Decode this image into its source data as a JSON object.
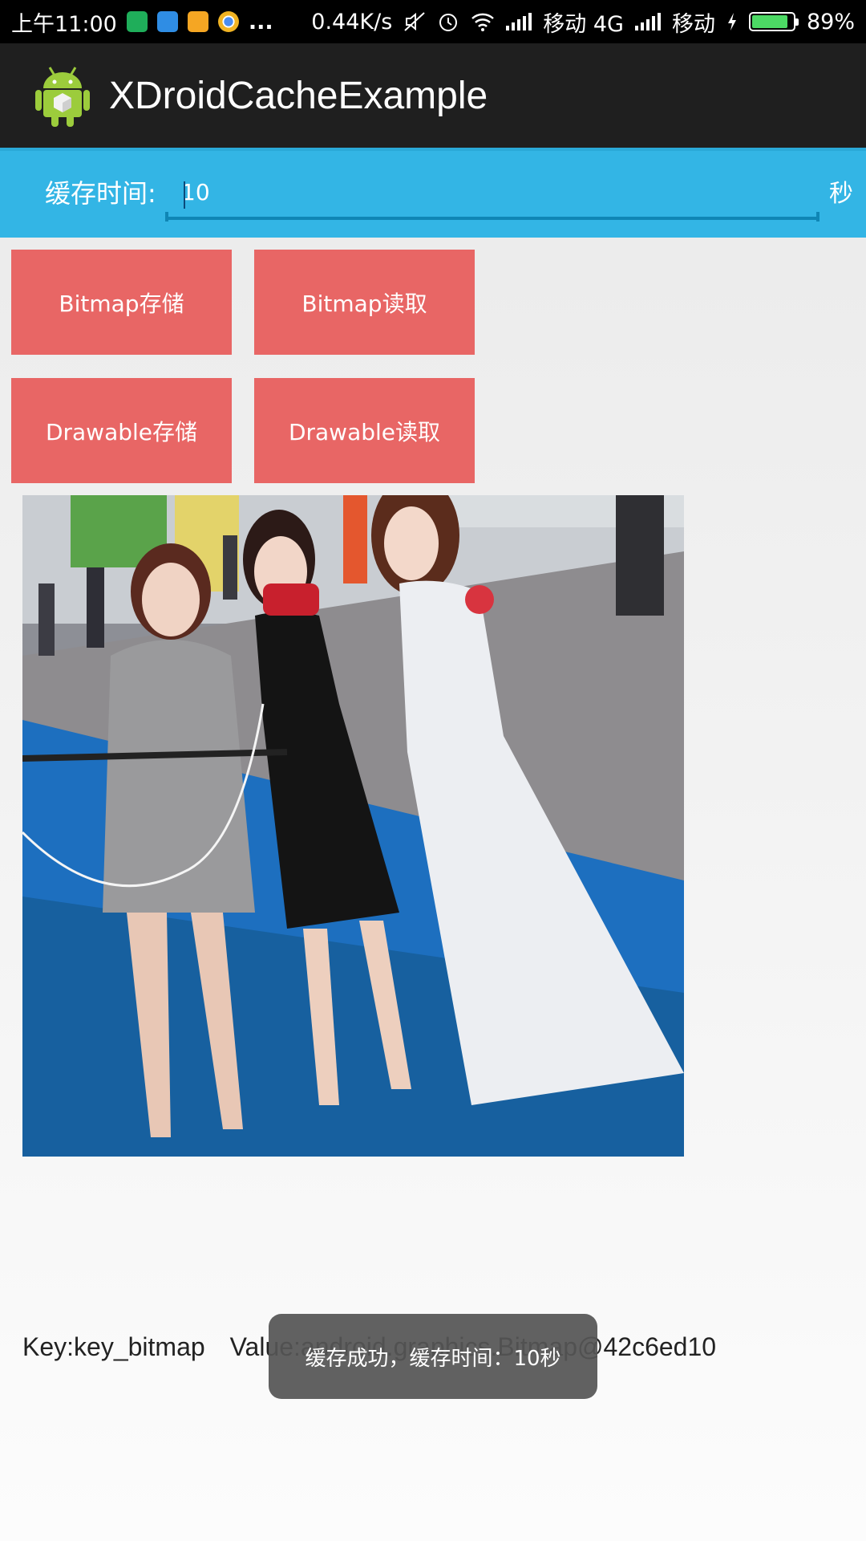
{
  "status_bar": {
    "time": "上午11:00",
    "more": "...",
    "net_speed": "0.44K/s",
    "carrier1": "移动 4G",
    "carrier2": "移动",
    "battery": "89%",
    "battery_level": 0.89,
    "icons": [
      "shield-icon",
      "message-icon",
      "weibo-icon",
      "chrome-icon",
      "mute-icon",
      "alarm-icon",
      "wifi-icon",
      "signal-icon",
      "charging-icon",
      "battery-icon"
    ]
  },
  "app_bar": {
    "title": "XDroidCacheExample",
    "icon": "android-icon"
  },
  "cache_time": {
    "label": "缓存时间:",
    "value": "10",
    "unit": "秒"
  },
  "buttons": {
    "bitmap_save": "Bitmap存储",
    "bitmap_read": "Bitmap读取",
    "drawable_save": "Drawable存储",
    "drawable_read": "Drawable读取"
  },
  "result": {
    "key": "Key:key_bitmap",
    "value": "Value:android.graphics.Bitmap@42c6ed10"
  },
  "toast": {
    "message": "缓存成功，缓存时间：10秒"
  },
  "colors": {
    "accent_blue": "#33b5e5",
    "button_red": "#e86665",
    "action_bar": "#1f1f1f"
  }
}
